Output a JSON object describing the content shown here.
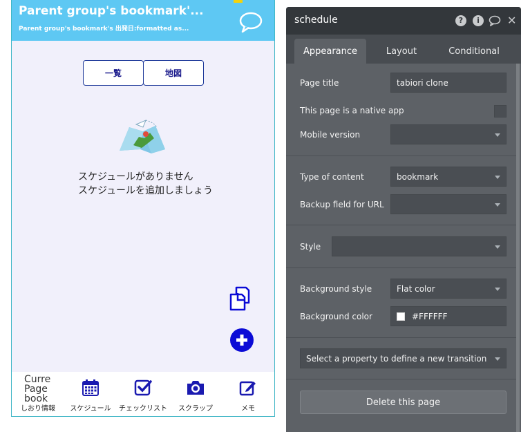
{
  "preview": {
    "header": {
      "title": "Parent group's bookmark'...",
      "subtitle": "Parent group's bookmark's 出発日:formatted as..."
    },
    "segment": {
      "left_label": "一覧",
      "right_label": "地図"
    },
    "empty_state": {
      "line1": "スケジュールがありません",
      "line2": "スケジュールを追加しましょう"
    },
    "tabbar": {
      "items": [
        {
          "label": "しおり情報",
          "icon": "broken-image",
          "alt_lines": [
            "Curre",
            "Page",
            "book"
          ]
        },
        {
          "label": "スケジュール",
          "icon": "calendar-icon"
        },
        {
          "label": "チェックリスト",
          "icon": "checklist-icon"
        },
        {
          "label": "スクラップ",
          "icon": "camera-icon"
        },
        {
          "label": "メモ",
          "icon": "edit-icon"
        }
      ]
    },
    "colors": {
      "header": "#5ec8f3",
      "accent": "#0b0bd6",
      "page_bg": "#f1f0fb"
    }
  },
  "editor": {
    "title": "schedule",
    "header_icons": [
      "help-icon",
      "info-icon",
      "comment-icon",
      "close-icon"
    ],
    "tabs": [
      "Appearance",
      "Layout",
      "Conditional"
    ],
    "active_tab": "Appearance",
    "fields": {
      "page_title_label": "Page title",
      "page_title_value": "tabiori clone",
      "native_app_label": "This page is a native app",
      "mobile_version_label": "Mobile version",
      "mobile_version_value": "",
      "type_of_content_label": "Type of content",
      "type_of_content_value": "bookmark",
      "backup_url_label": "Backup field for URL",
      "backup_url_value": "",
      "style_label": "Style",
      "style_value": "",
      "bg_style_label": "Background style",
      "bg_style_value": "Flat color",
      "bg_color_label": "Background color",
      "bg_color_value": "#FFFFFF",
      "transition_placeholder": "Select a property to define a new transition"
    },
    "delete_label": "Delete this page"
  }
}
